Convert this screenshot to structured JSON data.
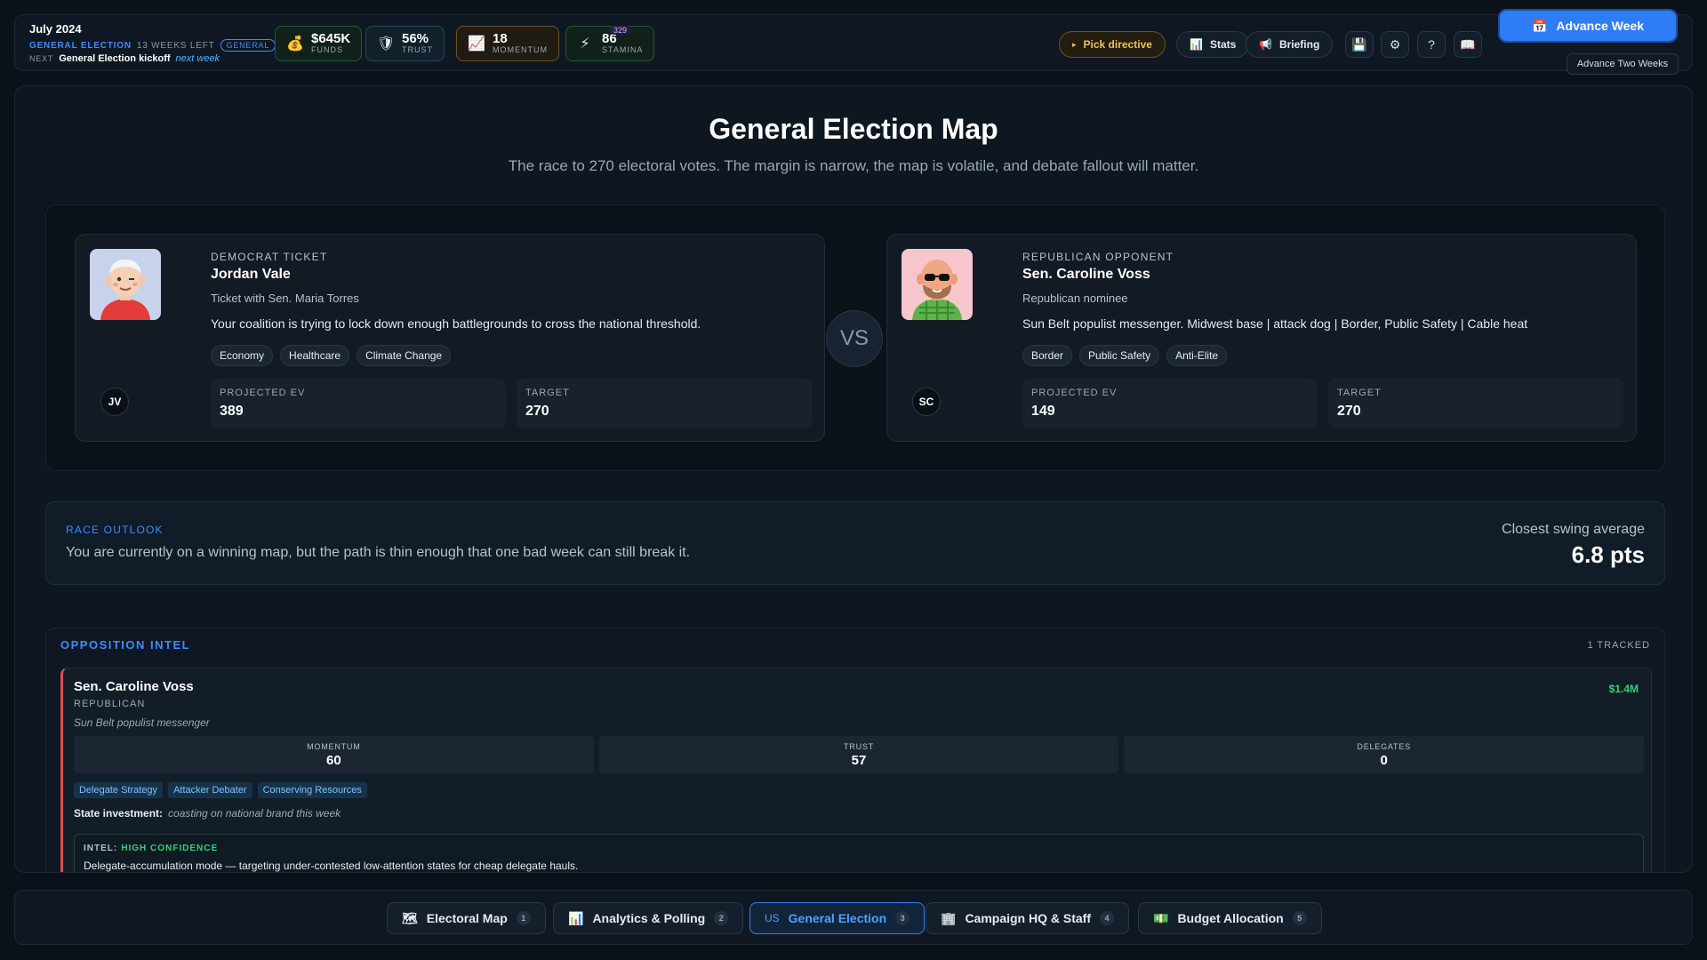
{
  "topbar": {
    "date": "July 2024",
    "phase": "GENERAL ELECTION",
    "weeks_left": "13 WEEKS LEFT",
    "phase_pill": "GENERAL",
    "next_label": "NEXT",
    "next_event": "General Election kickoff",
    "next_when": "next week",
    "stats": [
      {
        "icon": "money-bag-icon",
        "glyph": "💰",
        "value": "$645K",
        "label": "FUNDS",
        "color": "#2fd07a"
      },
      {
        "icon": "shield-icon",
        "glyph": "🛡",
        "value": "56%",
        "label": "TRUST",
        "color": "#3b8cff"
      },
      {
        "icon": "chart-icon",
        "glyph": "📈",
        "value": "18",
        "label": "MOMENTUM",
        "color": "#d9a441"
      },
      {
        "icon": "lightning-icon",
        "glyph": "⚡",
        "value": "86",
        "label": "STAMINA",
        "color": "#2fd07a",
        "badge": "329"
      }
    ],
    "buttons": {
      "pick_directive": "Pick directive",
      "stats": "Stats",
      "briefing": "Briefing"
    },
    "advance_week": "Advance Week",
    "advance_two": "Advance Two Weeks"
  },
  "main": {
    "title": "General Election Map",
    "subtitle": "The race to 270 electoral votes. The margin is narrow, the map is volatile, and debate fallout will matter.",
    "player": {
      "label": "DEMOCRAT TICKET",
      "name": "Jordan Vale",
      "sub": "Ticket with Sen. Maria Torres",
      "desc": "Your coalition is trying to lock down enough battlegrounds to cross the national threshold.",
      "tags": [
        "Economy",
        "Healthcare",
        "Climate Change"
      ],
      "initials": "JV",
      "ev_label": "PROJECTED EV",
      "ev": "389",
      "target_label": "TARGET",
      "target": "270"
    },
    "vs": "VS",
    "opponent": {
      "label": "REPUBLICAN OPPONENT",
      "name": "Sen. Caroline Voss",
      "sub": "Republican nominee",
      "desc": "Sun Belt populist messenger. Midwest base | attack dog | Border, Public Safety | Cable heat",
      "tags": [
        "Border",
        "Public Safety",
        "Anti-Elite"
      ],
      "initials": "SC",
      "ev_label": "PROJECTED EV",
      "ev": "149",
      "target_label": "TARGET",
      "target": "270"
    },
    "outlook": {
      "label": "RACE OUTLOOK",
      "text": "You are currently on a winning map, but the path is thin enough that one bad week can still break it.",
      "closest_label": "Closest swing average",
      "closest_value": "6.8 pts"
    },
    "intel": {
      "header": "OPPOSITION INTEL",
      "tracked": "1 TRACKED",
      "name": "Sen. Caroline Voss",
      "party": "REPUBLICAN",
      "funds": "$1.4M",
      "archetype": "Sun Belt populist messenger",
      "metrics": [
        {
          "label": "MOMENTUM",
          "value": "60"
        },
        {
          "label": "TRUST",
          "value": "57"
        },
        {
          "label": "DELEGATES",
          "value": "0"
        }
      ],
      "tags": [
        "Delegate Strategy",
        "Attacker Debater",
        "Conserving Resources"
      ],
      "state_label": "State investment:",
      "state_value": "coasting on national brand this week",
      "intel_label": "INTEL:",
      "confidence": "HIGH CONFIDENCE",
      "intel_text": "Delegate-accumulation mode — targeting under-contested low-attention states for cheap delegate hauls."
    }
  },
  "tabs": [
    {
      "label": "Electoral Map",
      "num": "1",
      "icon": "map-icon"
    },
    {
      "label": "Analytics & Polling",
      "num": "2",
      "icon": "bar-chart-icon"
    },
    {
      "label": "General Election",
      "num": "3",
      "icon": "us-flag-icon",
      "prefix": "US"
    },
    {
      "label": "Campaign HQ & Staff",
      "num": "4",
      "icon": "building-icon"
    },
    {
      "label": "Budget Allocation",
      "num": "5",
      "icon": "money-icon"
    }
  ]
}
